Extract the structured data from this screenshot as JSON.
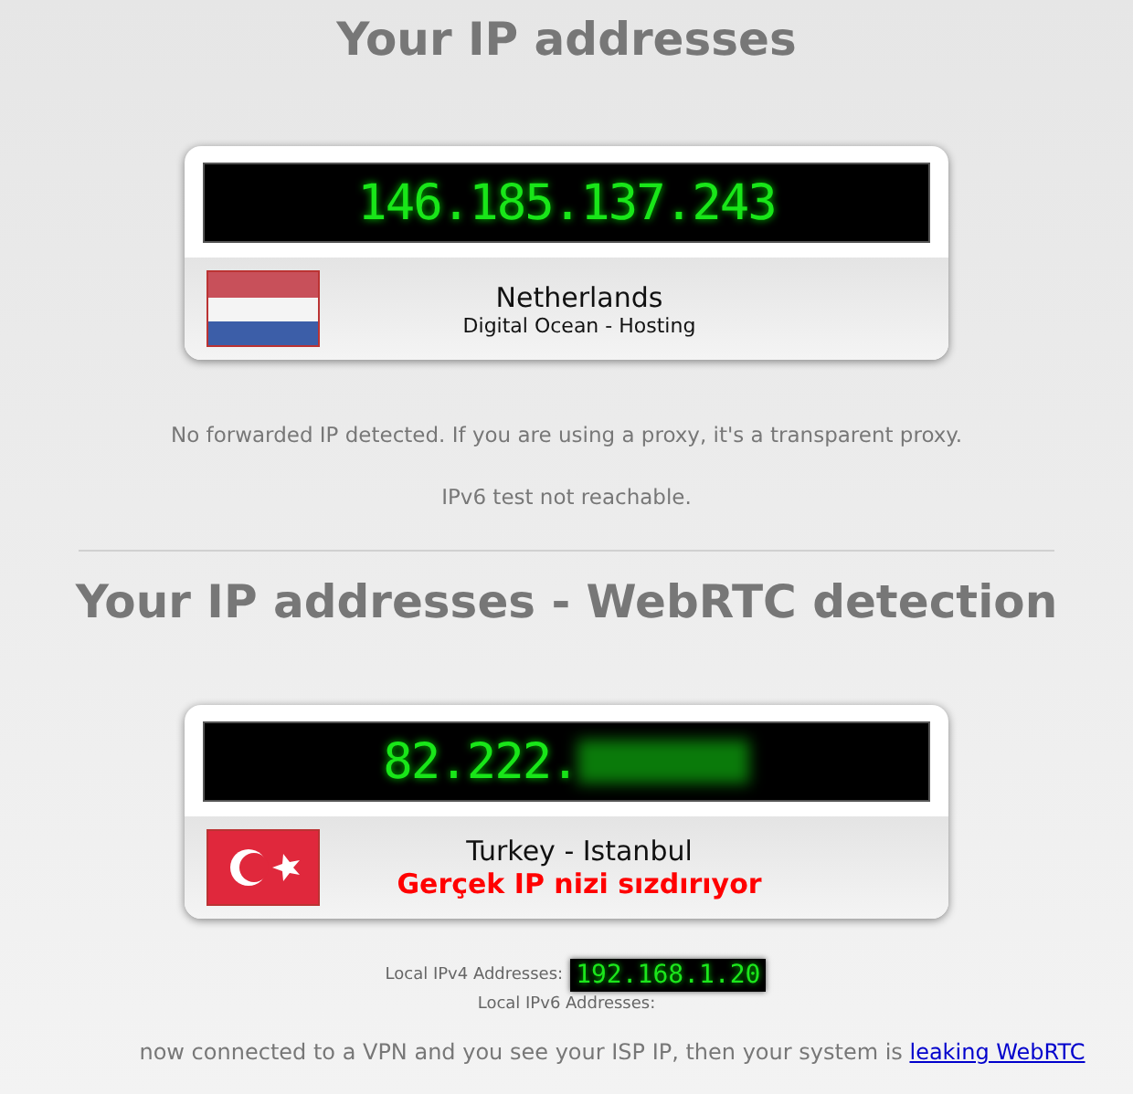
{
  "sections": [
    {
      "title": "Your IP addresses",
      "ip_parts": [
        {
          "kind": "digits",
          "text": "146.185.137.243"
        }
      ],
      "flag": {
        "kind": "netherlands"
      },
      "location": "Netherlands",
      "detail": {
        "kind": "isp",
        "text": "Digital Ocean - Hosting"
      },
      "notes": [
        "No forwarded IP detected. If you are using a proxy, it's a transparent proxy.",
        "IPv6 test not reachable."
      ]
    },
    {
      "title": "Your IP addresses - WebRTC detection",
      "ip_parts": [
        {
          "kind": "digits",
          "text": "82.222."
        },
        {
          "kind": "blurred"
        }
      ],
      "flag": {
        "kind": "turkey"
      },
      "location": "Turkey - Istanbul",
      "detail": {
        "kind": "warning",
        "text": "Gerçek IP nizi sızdırıyor"
      }
    }
  ],
  "local": {
    "ipv4_label": "Local IPv4 Addresses:",
    "ipv4": "192.168.1.20",
    "ipv6_label": "Local IPv6 Addresses:"
  },
  "footer": {
    "text": "now connected to a VPN and you see your ISP IP, then your system is ",
    "link": "leaking WebRTC"
  }
}
